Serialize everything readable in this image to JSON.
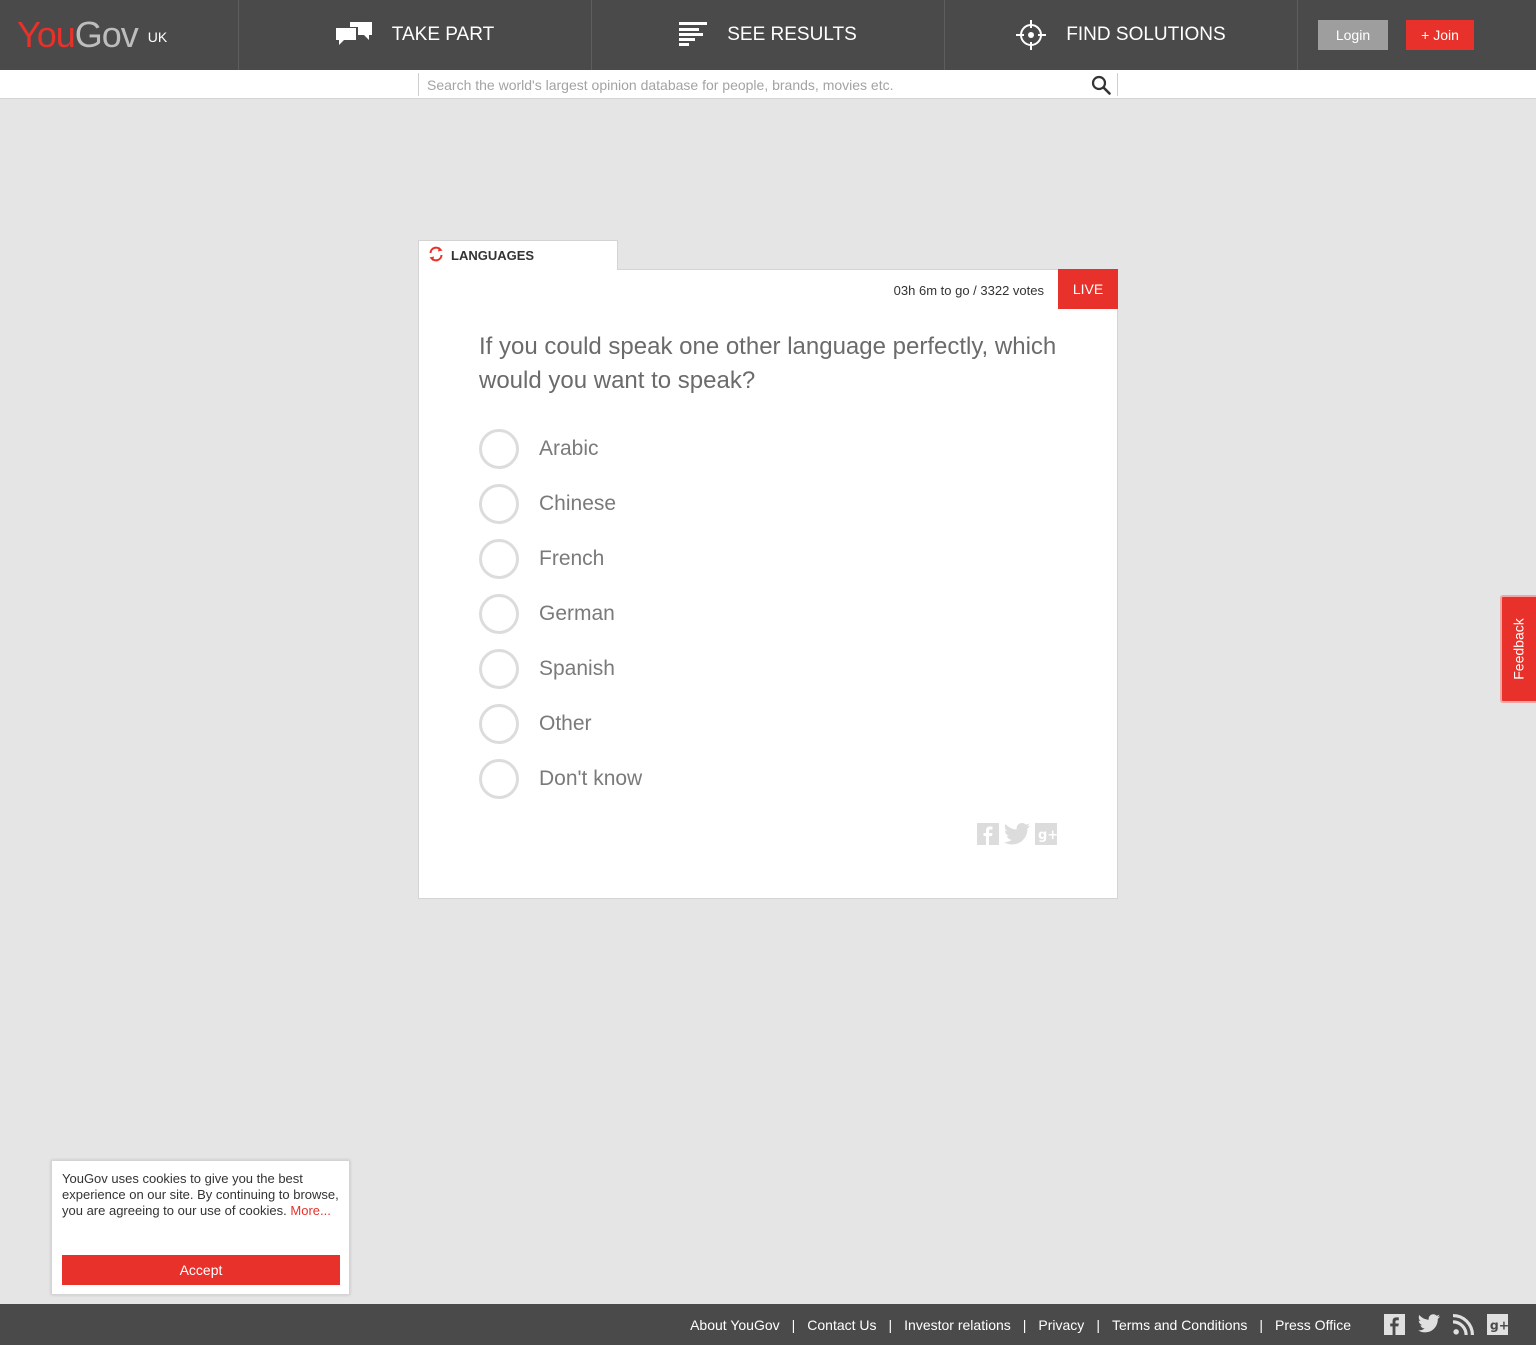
{
  "header": {
    "logo_you": "You",
    "logo_gov": "Gov",
    "region": "UK",
    "nav": [
      {
        "label": "TAKE PART",
        "icon": "speech-bubbles-icon"
      },
      {
        "label": "SEE RESULTS",
        "icon": "bar-list-icon"
      },
      {
        "label": "FIND SOLUTIONS",
        "icon": "crosshair-icon"
      }
    ],
    "login_label": "Login",
    "join_label": "+ Join"
  },
  "search": {
    "placeholder": "Search the world's largest opinion database for people, brands, movies etc.",
    "value": "",
    "icon": "search-icon"
  },
  "poll": {
    "category": "LANGUAGES",
    "meta": "03h 6m to go / 3322 votes",
    "status": "LIVE",
    "question": "If you could speak one other language perfectly, which would you want to speak?",
    "options": [
      "Arabic",
      "Chinese",
      "French",
      "German",
      "Spanish",
      "Other",
      "Don't know"
    ],
    "share_icons": [
      "facebook-icon",
      "twitter-icon",
      "google-plus-icon"
    ]
  },
  "feedback": {
    "label": "Feedback"
  },
  "cookie": {
    "text": "YouGov uses cookies to give you the best experience on our site. By continuing to browse, you are agreeing to our use of cookies.",
    "more_label": "More...",
    "accept_label": "Accept"
  },
  "footer": {
    "links": [
      "About YouGov",
      "Contact Us",
      "Investor relations",
      "Privacy",
      "Terms and Conditions",
      "Press Office"
    ],
    "separator": "|",
    "social_icons": [
      "facebook-icon",
      "twitter-icon",
      "rss-icon",
      "google-plus-icon"
    ]
  },
  "colors": {
    "brand_red": "#e8312a",
    "header_bg": "#4a4a4a",
    "page_bg": "#e5e5e5"
  }
}
